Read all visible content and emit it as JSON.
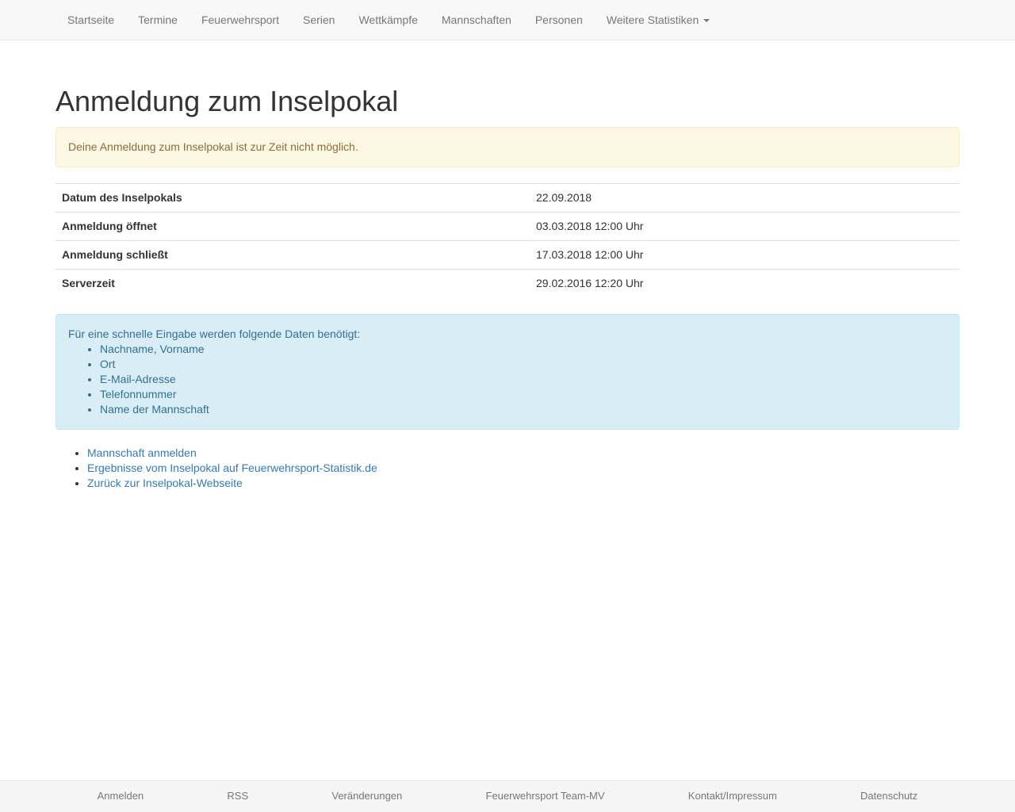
{
  "nav": {
    "items": [
      {
        "label": "Startseite"
      },
      {
        "label": "Termine"
      },
      {
        "label": "Feuerwehrsport"
      },
      {
        "label": "Serien"
      },
      {
        "label": "Wettkämpfe"
      },
      {
        "label": "Mannschaften"
      },
      {
        "label": "Personen"
      },
      {
        "label": "Weitere Statistiken"
      }
    ]
  },
  "page": {
    "title": "Anmeldung zum Inselpokal",
    "warning": "Deine Anmeldung zum Inselpokal ist zur Zeit nicht möglich."
  },
  "info_table": {
    "rows": [
      {
        "label": "Datum des Inselpokals",
        "value": "22.09.2018"
      },
      {
        "label": "Anmeldung öffnet",
        "value": "03.03.2018 12:00 Uhr"
      },
      {
        "label": "Anmeldung schließt",
        "value": "17.03.2018 12:00 Uhr"
      },
      {
        "label": "Serverzeit",
        "value": "29.02.2016 12:20 Uhr"
      }
    ]
  },
  "requirements": {
    "intro": "Für eine schnelle Eingabe werden folgende Daten benötigt:",
    "items": [
      "Nachname, Vorname",
      "Ort",
      "E-Mail-Adresse",
      "Telefonnummer",
      "Name der Mannschaft"
    ]
  },
  "links": {
    "items": [
      "Mannschaft anmelden",
      "Ergebnisse vom Inselpokal auf Feuerwehrsport-Statistik.de",
      "Zurück zur Inselpokal-Webseite"
    ]
  },
  "footer": {
    "items": [
      "Anmelden",
      "RSS",
      "Veränderungen",
      "Feuerwehrsport Team-MV",
      "Kontakt/Impressum",
      "Datenschutz"
    ]
  },
  "colors": {
    "link": "#337ab7",
    "warning_bg": "#fcf8e3",
    "warning_text": "#8a6d3b",
    "info_bg": "#d9edf7",
    "info_text": "#31708f",
    "nav_text": "#777777"
  },
  "icons": {
    "dropdown": "caret-down-icon"
  }
}
